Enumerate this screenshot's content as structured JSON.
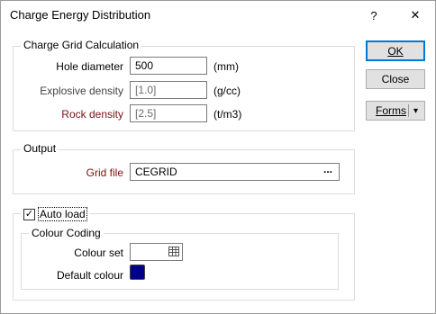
{
  "dialog": {
    "title": "Charge Energy Distribution",
    "help_glyph": "?",
    "close_glyph": "✕"
  },
  "charge_grid": {
    "legend": "Charge Grid Calculation",
    "hole_diameter": {
      "label": "Hole diameter",
      "value": "500",
      "unit": "(mm)"
    },
    "explosive_density": {
      "label": "Explosive density",
      "value": "[1.0]",
      "unit": "(g/cc)"
    },
    "rock_density": {
      "label": "Rock density",
      "value": "[2.5]",
      "unit": "(t/m3)"
    }
  },
  "output": {
    "legend": "Output",
    "grid_file": {
      "label": "Grid file",
      "value": "CEGRID",
      "browse": "..."
    }
  },
  "auto_load": {
    "label": "Auto load",
    "checked": true,
    "colour_coding": {
      "legend": "Colour Coding",
      "colour_set_label": "Colour set",
      "colour_set_value": "",
      "default_colour_label": "Default colour",
      "default_colour": "#00008b"
    }
  },
  "buttons": {
    "ok": "OK",
    "close": "Close",
    "forms": "Forms",
    "forms_arrow": "▾"
  }
}
